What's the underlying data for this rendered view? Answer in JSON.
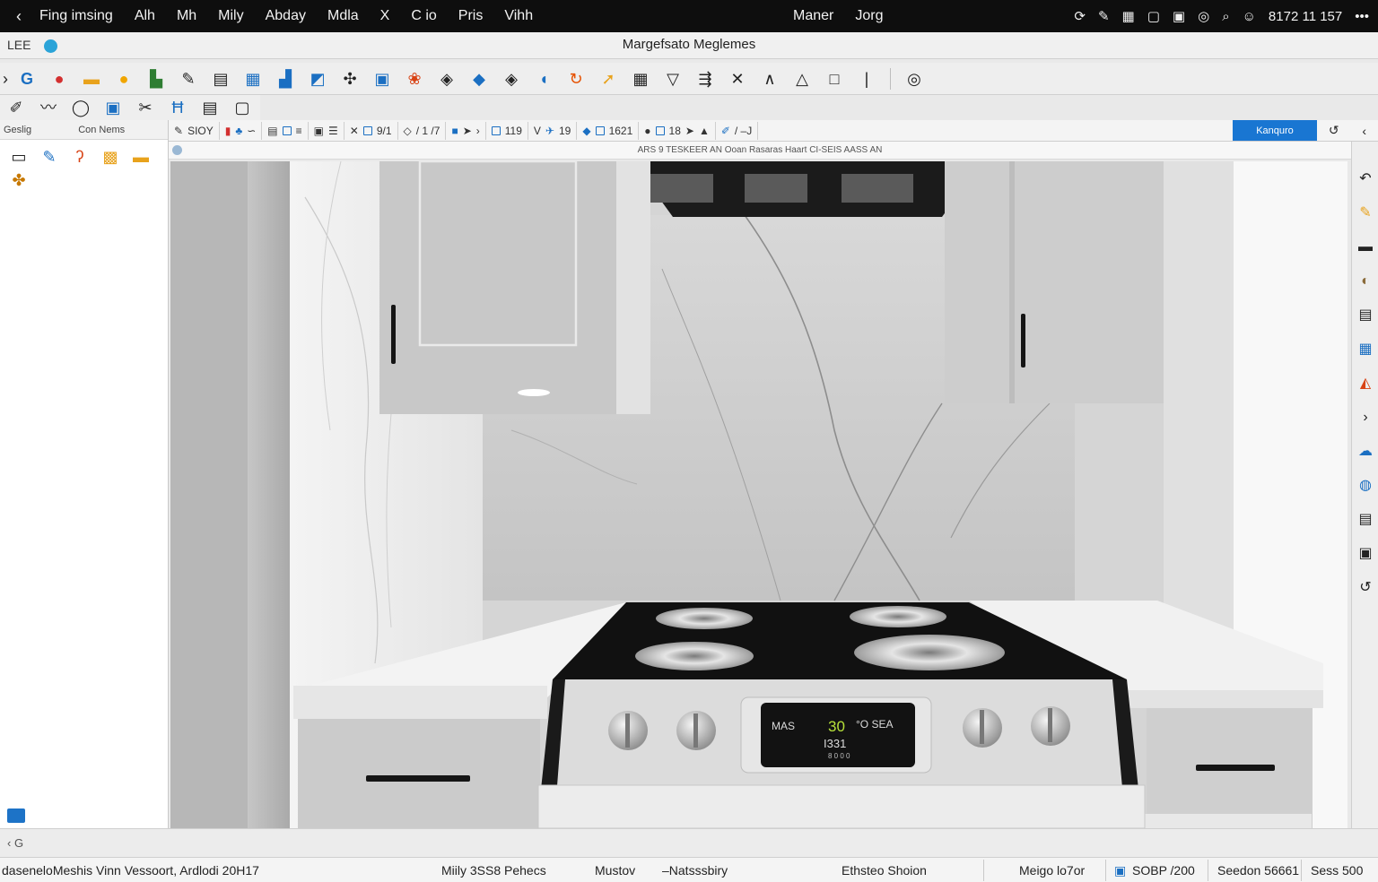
{
  "menubar": {
    "items": [
      "Fing imsing",
      "Alh",
      "Mh",
      "Mily",
      "Abday",
      "Mdla",
      "X",
      "C io",
      "Pris",
      "Vihh"
    ],
    "right_items": [
      "Maner",
      "Jorg"
    ],
    "clock": "8172 11 157"
  },
  "titlebar": {
    "doc_label": "LEE",
    "title": "Margefsato Meglemes"
  },
  "left_panel": {
    "header_a": "Geslig",
    "header_b": "Con Nems"
  },
  "toolbar3": {
    "groups": [
      "SIOY",
      "",
      "",
      "",
      "",
      "9/1",
      "/ 1 /7",
      "",
      "",
      "119",
      "19",
      "1621",
      "18",
      "/ –J"
    ],
    "blue_button": "Kanquro"
  },
  "infobar": {
    "text": "ARS 9 TESKEER AN Ooan Rasaras Haart CI-SEIS AASS AN"
  },
  "stove_display": {
    "left": "MAS",
    "value": "30",
    "right": "°O SEA",
    "lower_mid": "I331",
    "lower_small": "8 0 0 0"
  },
  "cmdline": {
    "prompt": "‹ G"
  },
  "statusbar": {
    "s1": "daseneloMeshis Vinn Vessoort, Ardlodi 20H17",
    "s2": "Miily 3SS8 Pehecs",
    "s3": "Mustov",
    "s4": "–Natsssbiry",
    "s5": "Ethsteo Shoion",
    "s6": "Meigo lo7or",
    "s7": "SOBP /200",
    "s8": "Seedon 56661",
    "s9": "Sess 500"
  },
  "colors": {
    "accent": "#1976d2",
    "menubar_bg": "#0e0e0e",
    "cabinet": "#cfcfcf",
    "countertop": "#f3f3f3",
    "cooktop": "#111111",
    "display_text": "#b7e23a"
  }
}
